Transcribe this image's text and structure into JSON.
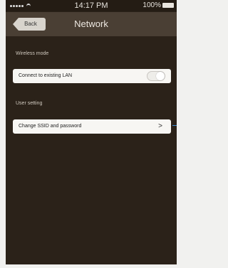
{
  "status_bar": {
    "time": "14:17 PM",
    "battery": "100%"
  },
  "navbar": {
    "back_label": "Back",
    "title": "Network"
  },
  "sections": {
    "wireless_mode": {
      "label": "Wireless mode",
      "row_label": "Connect to existing LAN",
      "toggle_on": false
    },
    "user_setting": {
      "label": "User setting",
      "row_label": "Change SSID and password",
      "chevron_icon": "chevron-right-icon"
    }
  },
  "colors": {
    "background": "#2b2219",
    "navbar": "#4a3f34",
    "row": "#f7f6f3",
    "accent_blue": "#3c8fd6"
  }
}
